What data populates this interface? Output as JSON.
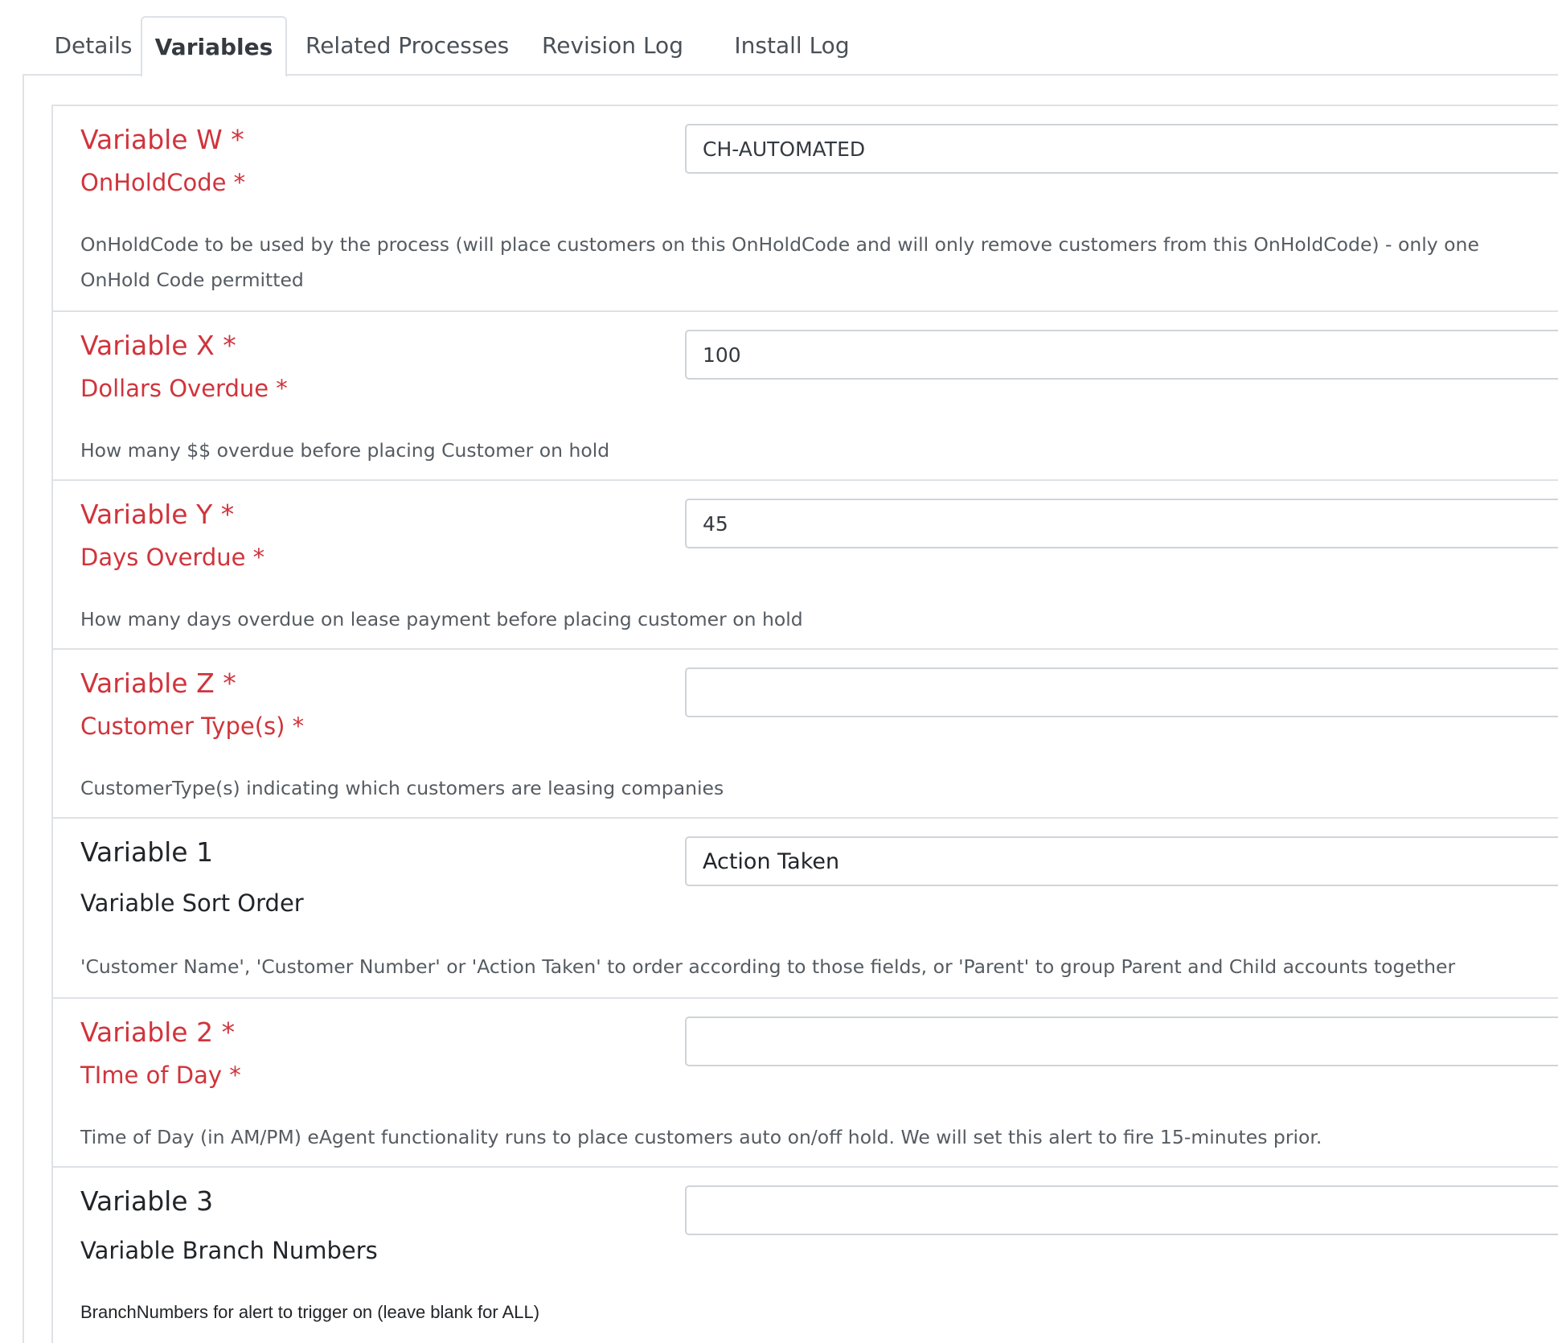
{
  "tabs": [
    {
      "label": "Details"
    },
    {
      "label": "Variables"
    },
    {
      "label": "Related Processes"
    },
    {
      "label": "Revision Log"
    },
    {
      "label": "Install Log"
    }
  ],
  "variables": [
    {
      "title": "Variable W *",
      "subtitle": "OnHoldCode *",
      "description": "OnHoldCode to be used by the process (will place customers on this OnHoldCode and will only remove customers from this OnHoldCode) - only one OnHold Code permitted",
      "value": "CH-AUTOMATED"
    },
    {
      "title": "Variable X *",
      "subtitle": "Dollars Overdue *",
      "description": "How many $$ overdue before placing Customer on hold",
      "value": "100"
    },
    {
      "title": "Variable Y *",
      "subtitle": "Days Overdue *",
      "description": "How many days overdue on lease payment before placing customer on hold",
      "value": "45"
    },
    {
      "title": "Variable Z *",
      "subtitle": "Customer Type(s) *",
      "description": "CustomerType(s) indicating which customers are leasing companies",
      "value": ""
    },
    {
      "title": "Variable 1",
      "subtitle": "Variable Sort Order",
      "description": "'Customer Name', 'Customer Number' or 'Action Taken' to order according to those fields, or 'Parent' to group Parent and Child accounts together",
      "value": "Action Taken"
    },
    {
      "title": "Variable 2 *",
      "subtitle": "TIme of Day *",
      "description": "Time of Day (in AM/PM) eAgent functionality runs to place customers auto on/off hold. We will set this alert to fire 15-minutes prior.",
      "value": ""
    },
    {
      "title": "Variable 3",
      "subtitle": "Variable Branch Numbers",
      "description": "BranchNumbers for alert to trigger on (leave blank for ALL)",
      "value": ""
    }
  ],
  "colors": {
    "required": "#d0343c",
    "optional": "#212529",
    "border": "#dee2e6"
  }
}
